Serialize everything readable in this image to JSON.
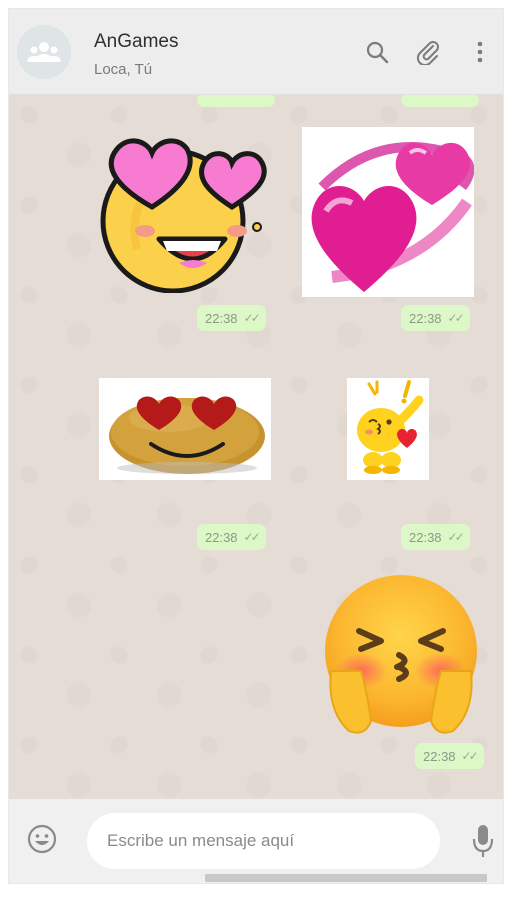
{
  "header": {
    "title": "AnGames",
    "subtitle": "Loca, Tú",
    "icons": [
      "group-avatar-icon",
      "search-icon",
      "attach-icon",
      "menu-icon"
    ]
  },
  "messages": [
    {
      "time": "22:38",
      "status": "read",
      "sticker": "heart-eyes-face-sticker"
    },
    {
      "time": "22:38",
      "status": "read",
      "sticker": "orbiting-hearts-sticker"
    },
    {
      "time": "22:38",
      "status": "read",
      "sticker": "potato-heart-eyes-sticker"
    },
    {
      "time": "22:38",
      "status": "read",
      "sticker": "blowing-kiss-character-sticker"
    },
    {
      "time": "22:38",
      "status": "read",
      "sticker": "kissing-blushing-face-sticker"
    }
  ],
  "composer": {
    "placeholder": "Escribe un mensaje aquí"
  },
  "colors": {
    "header_bg": "#ededed",
    "chat_bg": "#e5ddd5",
    "bubble_bg": "#dcf8c6",
    "icon": "#919191"
  }
}
